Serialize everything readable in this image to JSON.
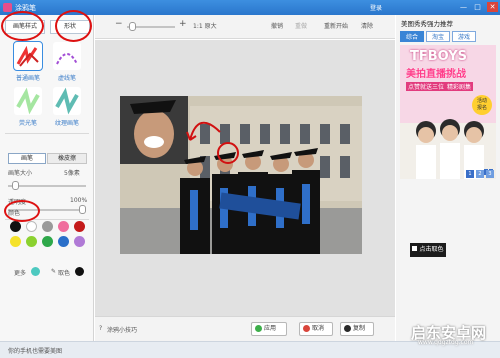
{
  "window": {
    "title": "涂鸦笔",
    "login_label": "登录",
    "minimize_glyph": "—",
    "maximize_glyph": "□",
    "close_glyph": "✕"
  },
  "left_panel": {
    "tabs": [
      {
        "label": "画笔样式"
      },
      {
        "label": "形状"
      }
    ],
    "brushes": [
      {
        "label": "普通画笔"
      },
      {
        "label": "虚线笔"
      },
      {
        "label": "荧光笔"
      },
      {
        "label": "纹理画笔"
      }
    ],
    "mode_buttons": [
      {
        "label": "画笔"
      },
      {
        "label": "橡皮擦"
      }
    ],
    "brush_size": {
      "label": "画笔大小",
      "value": "5像素",
      "level": 0.05
    },
    "opacity": {
      "label": "透明度",
      "value": "100%",
      "level": 1.0
    },
    "color_section_label": "颜色",
    "colors": [
      "#111111",
      "#ffffff",
      "#9a9a9a",
      "#f06d9d",
      "#c41a1a",
      "#f5e22a",
      "#8bd12f",
      "#2ea84a",
      "#2a6fc9",
      "#b07ad6"
    ],
    "more_label": "更多",
    "picker_label": "取色",
    "picker_color": "#111111"
  },
  "toolbar": {
    "zoom_minus_glyph": "−",
    "zoom_plus_glyph": "+",
    "zoom_actual_label": "1:1 原大",
    "undo_label": "撤销",
    "redo_label": "重做",
    "restart_label": "重新开始",
    "clear_label": "清除"
  },
  "bottom_bar": {
    "tips_label": "涂鸦小技巧",
    "apply_label": "应用",
    "cancel_label": "取消",
    "copy_label": "复制"
  },
  "right_panel": {
    "title": "美图秀秀强力推荐",
    "tabs": [
      {
        "label": "综合"
      },
      {
        "label": "淘宝"
      },
      {
        "label": "游戏"
      }
    ],
    "ad": {
      "headline_1": "TFBOYS",
      "headline_2": "美拍直播挑战",
      "subline": "点赞就送三位",
      "subline_2": "精彩剧集",
      "badge": "活动\n报名",
      "pages": [
        "1",
        "2",
        "3"
      ]
    },
    "tooltip": "点击取色"
  },
  "status_bar": {
    "text": "你的手机也需要美图",
    "watermark": "启东安卓网",
    "watermark_url": "www.qdgztdg.com"
  },
  "colors": {
    "accent": "#3a85d6",
    "annotation_red": "#d11111"
  }
}
